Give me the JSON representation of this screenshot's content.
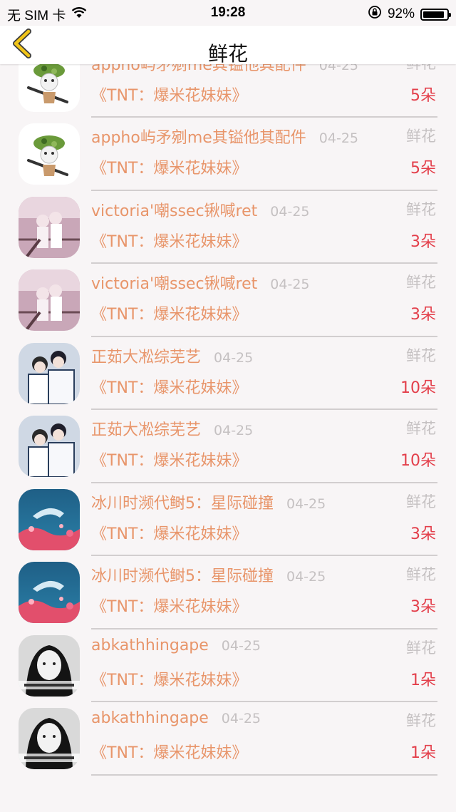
{
  "status": {
    "carrier": "无 SIM 卡",
    "time": "19:28",
    "battery_pct": "92%",
    "battery_level": 0.92
  },
  "nav": {
    "title": "鲜花",
    "back_icon": "chevron-left-icon",
    "accent": "#f0c419"
  },
  "colors": {
    "name": "#e8956a",
    "meta": "#c5c1c2",
    "count": "#e33e4a"
  },
  "rows": [
    {
      "name": "",
      "date": "",
      "type": "",
      "song": "《TNT：爆米花妹妹》",
      "count": "3朵",
      "avatar": "blue"
    },
    {
      "name": "appho屿矛剜me其镒他其配件",
      "date": "04-25",
      "type": "鲜花",
      "song": "《TNT：爆米花妹妹》",
      "count": "5朵",
      "avatar": "soldier"
    },
    {
      "name": "appho屿矛剜me其镒他其配件",
      "date": "04-25",
      "type": "鲜花",
      "song": "《TNT：爆米花妹妹》",
      "count": "5朵",
      "avatar": "soldier"
    },
    {
      "name": "victoria'嘲ssec锹喊ret",
      "date": "04-25",
      "type": "鲜花",
      "song": "《TNT：爆米花妹妹》",
      "count": "3朵",
      "avatar": "pink-couple"
    },
    {
      "name": "victoria'嘲ssec锹喊ret",
      "date": "04-25",
      "type": "鲜花",
      "song": "《TNT：爆米花妹妹》",
      "count": "3朵",
      "avatar": "pink-couple"
    },
    {
      "name": "正茹大凇综芜艺",
      "date": "04-25",
      "type": "鲜花",
      "song": "《TNT：爆米花妹妹》",
      "count": "10朵",
      "avatar": "white-couple"
    },
    {
      "name": "正茹大凇综芜艺",
      "date": "04-25",
      "type": "鲜花",
      "song": "《TNT：爆米花妹妹》",
      "count": "10朵",
      "avatar": "white-couple"
    },
    {
      "name": "冰川时濒代鲥5：星际碰撞",
      "date": "04-25",
      "type": "鲜花",
      "song": "《TNT：爆米花妹妹》",
      "count": "3朵",
      "avatar": "whale"
    },
    {
      "name": "冰川时濒代鲥5：星际碰撞",
      "date": "04-25",
      "type": "鲜花",
      "song": "《TNT：爆米花妹妹》",
      "count": "3朵",
      "avatar": "whale"
    },
    {
      "name": "abkathhingape",
      "date": "04-25",
      "type": "鲜花",
      "song": "《TNT：爆米花妹妹》",
      "count": "1朵",
      "avatar": "bw-girl"
    },
    {
      "name": "abkathhingape",
      "date": "04-25",
      "type": "鲜花",
      "song": "《TNT：爆米花妹妹》",
      "count": "1朵",
      "avatar": "bw-girl"
    }
  ]
}
